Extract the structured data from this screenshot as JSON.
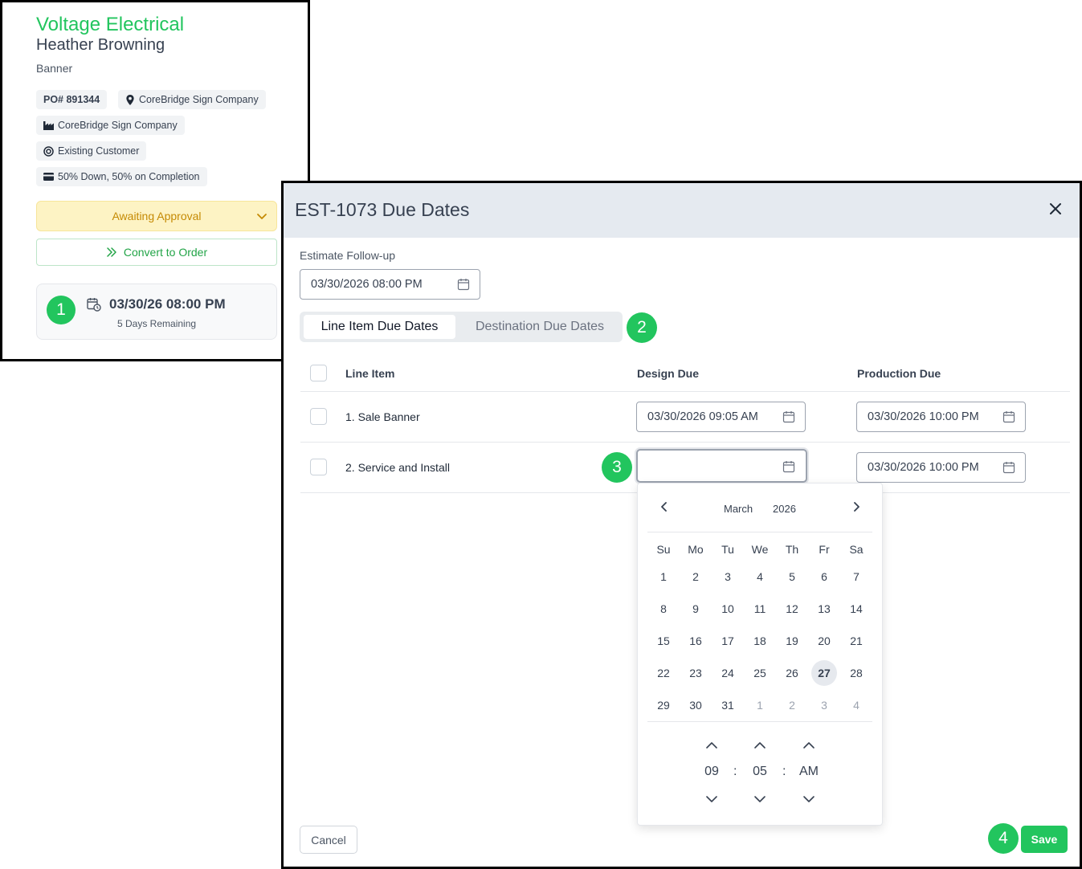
{
  "colors": {
    "brand_green": "#22c55e",
    "status_yellow": "#fdf3c4",
    "status_text": "#c58a04"
  },
  "card": {
    "company": "Voltage Electrical",
    "contact": "Heather Browning",
    "product": "Banner",
    "po_number": "PO# 891344",
    "location": "CoreBridge Sign Company",
    "company_chip": "CoreBridge Sign Company",
    "customer_type": "Existing Customer",
    "payment_terms": "50% Down, 50% on Completion",
    "status": "Awaiting Approval",
    "convert_label": "Convert to Order",
    "due_date": "03/30/26 08:00 PM",
    "due_remaining": "5 Days Remaining"
  },
  "badges": {
    "b1": "1",
    "b2": "2",
    "b3": "3",
    "b4": "4"
  },
  "modal": {
    "title": "EST-1073 Due Dates",
    "followup_label": "Estimate Follow-up",
    "followup_value": "03/30/2026 08:00 PM",
    "tabs": [
      "Line Item Due Dates",
      "Destination Due Dates"
    ],
    "columns": {
      "line_item": "Line Item",
      "design_due": "Design Due",
      "production_due": "Production Due"
    },
    "rows": [
      {
        "name": "1. Sale Banner",
        "design_due": "03/30/2026 09:05 AM",
        "production_due": "03/30/2026 10:00 PM"
      },
      {
        "name": "2. Service and Install",
        "design_due": "",
        "production_due": "03/30/2026 10:00 PM"
      }
    ],
    "cancel_label": "Cancel",
    "save_label": "Save"
  },
  "calendar": {
    "month": "March",
    "year": "2026",
    "weekdays": [
      "Su",
      "Mo",
      "Tu",
      "We",
      "Th",
      "Fr",
      "Sa"
    ],
    "weeks": [
      [
        "1",
        "2",
        "3",
        "4",
        "5",
        "6",
        "7"
      ],
      [
        "8",
        "9",
        "10",
        "11",
        "12",
        "13",
        "14"
      ],
      [
        "15",
        "16",
        "17",
        "18",
        "19",
        "20",
        "21"
      ],
      [
        "22",
        "23",
        "24",
        "25",
        "26",
        "27",
        "28"
      ],
      [
        "29",
        "30",
        "31",
        "1",
        "2",
        "3",
        "4"
      ]
    ],
    "selected_day": "27",
    "time": {
      "hour": "09",
      "minute": "05",
      "period": "AM",
      "separator": ":"
    }
  }
}
